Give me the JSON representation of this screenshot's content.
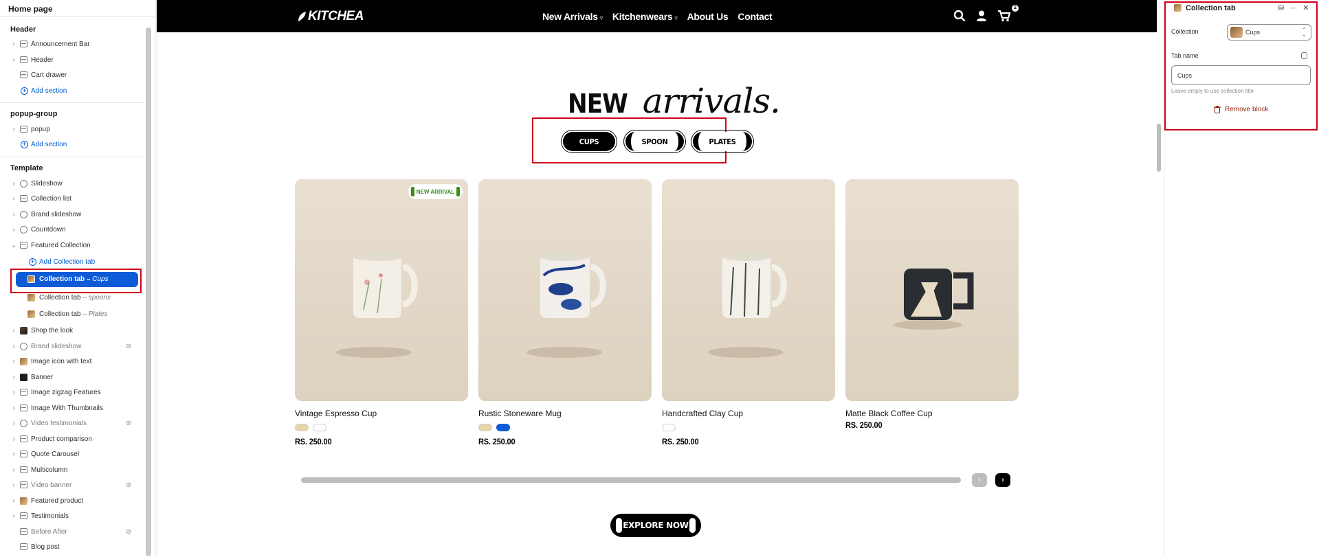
{
  "sidebar": {
    "title": "Home page",
    "header_group": {
      "label": "Header",
      "items": [
        "Announcement Bar",
        "Header",
        "Cart drawer"
      ],
      "add_label": "Add section"
    },
    "popup_group": {
      "label": "popup-group",
      "items": [
        "popup"
      ],
      "add_label": "Add section"
    },
    "template_group": {
      "label": "Template",
      "items_before": [
        "Slideshow",
        "Collection list",
        "Brand slideshow",
        "Countdown",
        "Featured Collection"
      ],
      "add_block_label": "Add Collection tab",
      "blocks": [
        {
          "label": "Collection tab",
          "sub": "Cups",
          "selected": true
        },
        {
          "label": "Collection tab",
          "sub": "spoons",
          "selected": false
        },
        {
          "label": "Collection tab",
          "sub": "Plates",
          "selected": false
        }
      ],
      "items_after": [
        {
          "label": "Shop the look",
          "hidden": false
        },
        {
          "label": "Brand slideshow",
          "hidden": true
        },
        {
          "label": "Image icon with text",
          "hidden": false
        },
        {
          "label": "Banner",
          "hidden": false
        },
        {
          "label": "Image zigzag Features",
          "hidden": false
        },
        {
          "label": "Image With Thumbnails",
          "hidden": false
        },
        {
          "label": "Video testimonials",
          "hidden": true
        },
        {
          "label": "Product comparison",
          "hidden": false
        },
        {
          "label": "Quote Carousel",
          "hidden": false
        },
        {
          "label": "Multicolumn",
          "hidden": false
        },
        {
          "label": "Video banner",
          "hidden": true
        },
        {
          "label": "Featured product",
          "hidden": false
        },
        {
          "label": "Testimonials",
          "hidden": false
        },
        {
          "label": "Before After",
          "hidden": true
        },
        {
          "label": "Blog post",
          "hidden": false
        }
      ]
    }
  },
  "store": {
    "logo": "KITCHEA",
    "menu": [
      {
        "label": "New Arrivals",
        "dropdown": true
      },
      {
        "label": "Kitchenwears",
        "dropdown": true
      },
      {
        "label": "About Us",
        "dropdown": false
      },
      {
        "label": "Contact",
        "dropdown": false
      }
    ],
    "cart_count": "2",
    "heading_bold": "NEW",
    "heading_script": "arrivals.",
    "tabs": [
      {
        "label": "CUPS",
        "active": true
      },
      {
        "label": "SPOON",
        "active": false
      },
      {
        "label": "PLATES",
        "active": false
      }
    ],
    "products": [
      {
        "name": "Vintage Espresso Cup",
        "price": "RS. 250.00",
        "badge": "NEW ARRIVAL",
        "swatches": [
          "#e8d5a8",
          "#ffffff"
        ]
      },
      {
        "name": "Rustic Stoneware Mug",
        "price": "RS. 250.00",
        "badge": "",
        "swatches": [
          "#e8d5a8",
          "#0d5bd7"
        ]
      },
      {
        "name": "Handcrafted Clay Cup",
        "price": "RS. 250.00",
        "badge": "",
        "swatches": [
          "#ffffff"
        ]
      },
      {
        "name": "Matte Black Coffee Cup",
        "price": "RS. 250.00",
        "badge": "",
        "swatches": []
      }
    ],
    "cta": "EXPLORE NOW"
  },
  "panel": {
    "title": "Collection tab",
    "collection_label": "Collection",
    "collection_value": "Cups",
    "tab_name_label": "Tab name",
    "tab_name_value": "Cups",
    "help_text": "Leave empty to use collection title",
    "remove_label": "Remove block"
  },
  "colors": {
    "selection_blue": "#0d5bd7",
    "highlight_red": "#d0021b",
    "remove_red": "#8e1f0b",
    "badge_green": "#3a8b22"
  }
}
